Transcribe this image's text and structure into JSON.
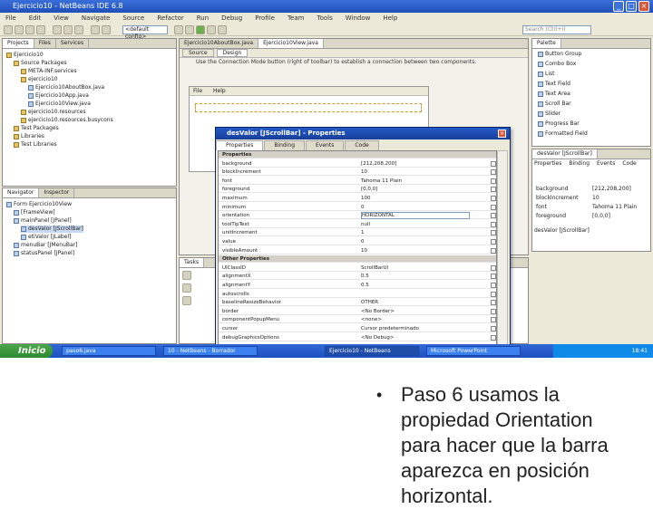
{
  "window": {
    "title": "Ejercicio10 - NetBeans IDE 6.8",
    "menu": [
      "File",
      "Edit",
      "View",
      "Navigate",
      "Source",
      "Refactor",
      "Run",
      "Debug",
      "Profile",
      "Team",
      "Tools",
      "Window",
      "Help"
    ],
    "config_value": "<default config>",
    "search_placeholder": "Search (Ctrl+I)"
  },
  "projects_panel": {
    "tabs": [
      "Projects",
      "Files",
      "Services"
    ],
    "tree": [
      {
        "label": "Ejercicio10",
        "type": "folder"
      },
      {
        "label": "Source Packages",
        "type": "folder"
      },
      {
        "label": "META-INF.services",
        "type": "folder"
      },
      {
        "label": "ejercicio10",
        "type": "folder"
      },
      {
        "label": "Ejercicio10AboutBox.java",
        "type": "java"
      },
      {
        "label": "Ejercicio10App.java",
        "type": "java"
      },
      {
        "label": "Ejercicio10View.java",
        "type": "java"
      },
      {
        "label": "ejercicio10.resources",
        "type": "folder"
      },
      {
        "label": "ejercicio10.resources.busycons",
        "type": "folder"
      },
      {
        "label": "Test Packages",
        "type": "folder"
      },
      {
        "label": "Libraries",
        "type": "folder"
      },
      {
        "label": "Test Libraries",
        "type": "folder"
      }
    ]
  },
  "navigator_panel": {
    "tabs": [
      "Navigator",
      "Inspector"
    ],
    "tree": [
      "Form Ejercicio10View",
      "[FrameView]",
      "mainPanel [JPanel]",
      "desValor [JScrollBar]",
      "etiValor [JLabel]",
      "menuBar [JMenuBar]",
      "statusPanel [JPanel]"
    ]
  },
  "editor": {
    "tabs": [
      "Ejercicio10AboutBox.java",
      "Ejercicio10View.java"
    ],
    "mode_tabs": [
      "Source",
      "Design"
    ],
    "hint": "Use the Connection Mode button (right of toolbar) to establish a connection between two components.",
    "form_menu": [
      "File",
      "Help"
    ]
  },
  "palette": {
    "title": "Palette",
    "items": [
      "Button Group",
      "Combo Box",
      "List",
      "Text Field",
      "Text Area",
      "Scroll Bar",
      "Slider",
      "Progress Bar",
      "Formatted Field"
    ],
    "props_title": "desValor [JScrollBar]",
    "props_tabs": [
      "Properties",
      "Binding",
      "Events",
      "Code"
    ],
    "props_rows": [
      {
        "name": "background",
        "value": "[212,208,200]"
      },
      {
        "name": "blockIncrement",
        "value": "10"
      },
      {
        "name": "font",
        "value": "Tahoma 11 Plain"
      },
      {
        "name": "foreground",
        "value": "[0,0,0]"
      }
    ],
    "footer": "desValor [JScrollBar]"
  },
  "tasks_panel": {
    "title": "Tasks"
  },
  "dialog": {
    "title": "desValor [JScrollBar] - Properties",
    "tabs": [
      "Properties",
      "Binding",
      "Events",
      "Code"
    ],
    "rows": [
      {
        "name": "Properties",
        "section": true
      },
      {
        "name": "background",
        "value": "[212,208,200]"
      },
      {
        "name": "blockIncrement",
        "value": "10"
      },
      {
        "name": "font",
        "value": "Tahoma 11 Plain"
      },
      {
        "name": "foreground",
        "value": "[0,0,0]"
      },
      {
        "name": "maximum",
        "value": "100"
      },
      {
        "name": "minimum",
        "value": "0"
      },
      {
        "name": "orientation",
        "value": "HORIZONTAL",
        "edit": true
      },
      {
        "name": "toolTipText",
        "value": "null"
      },
      {
        "name": "unitIncrement",
        "value": "1"
      },
      {
        "name": "value",
        "value": "0"
      },
      {
        "name": "visibleAmount",
        "value": "10"
      },
      {
        "name": "Other Properties",
        "section": true
      },
      {
        "name": "UIClassID",
        "value": "ScrollBarUI"
      },
      {
        "name": "alignmentX",
        "value": "0.5"
      },
      {
        "name": "alignmentY",
        "value": "0.5"
      },
      {
        "name": "autoscrolls",
        "value": ""
      },
      {
        "name": "baselineResizeBehavior",
        "value": "OTHER"
      },
      {
        "name": "border",
        "value": "<No Border>"
      },
      {
        "name": "componentPopupMenu",
        "value": "<none>"
      },
      {
        "name": "cursor",
        "value": "Cursor predeterminado"
      },
      {
        "name": "debugGraphicsOptions",
        "value": "<No Debug>"
      }
    ]
  },
  "taskbar": {
    "start": "Inicio",
    "tasks": [
      "paso6.java",
      "10 - NetBeans - Borrador",
      "Ejercicio10 - NetBeans",
      "Microsoft PowerPoint"
    ],
    "active_index": 2,
    "clock": "18:41"
  },
  "caption": {
    "bullet": "•",
    "text": "Paso 6  usamos la propiedad Orientation para hacer que la barra aparezca en posición horizontal."
  }
}
